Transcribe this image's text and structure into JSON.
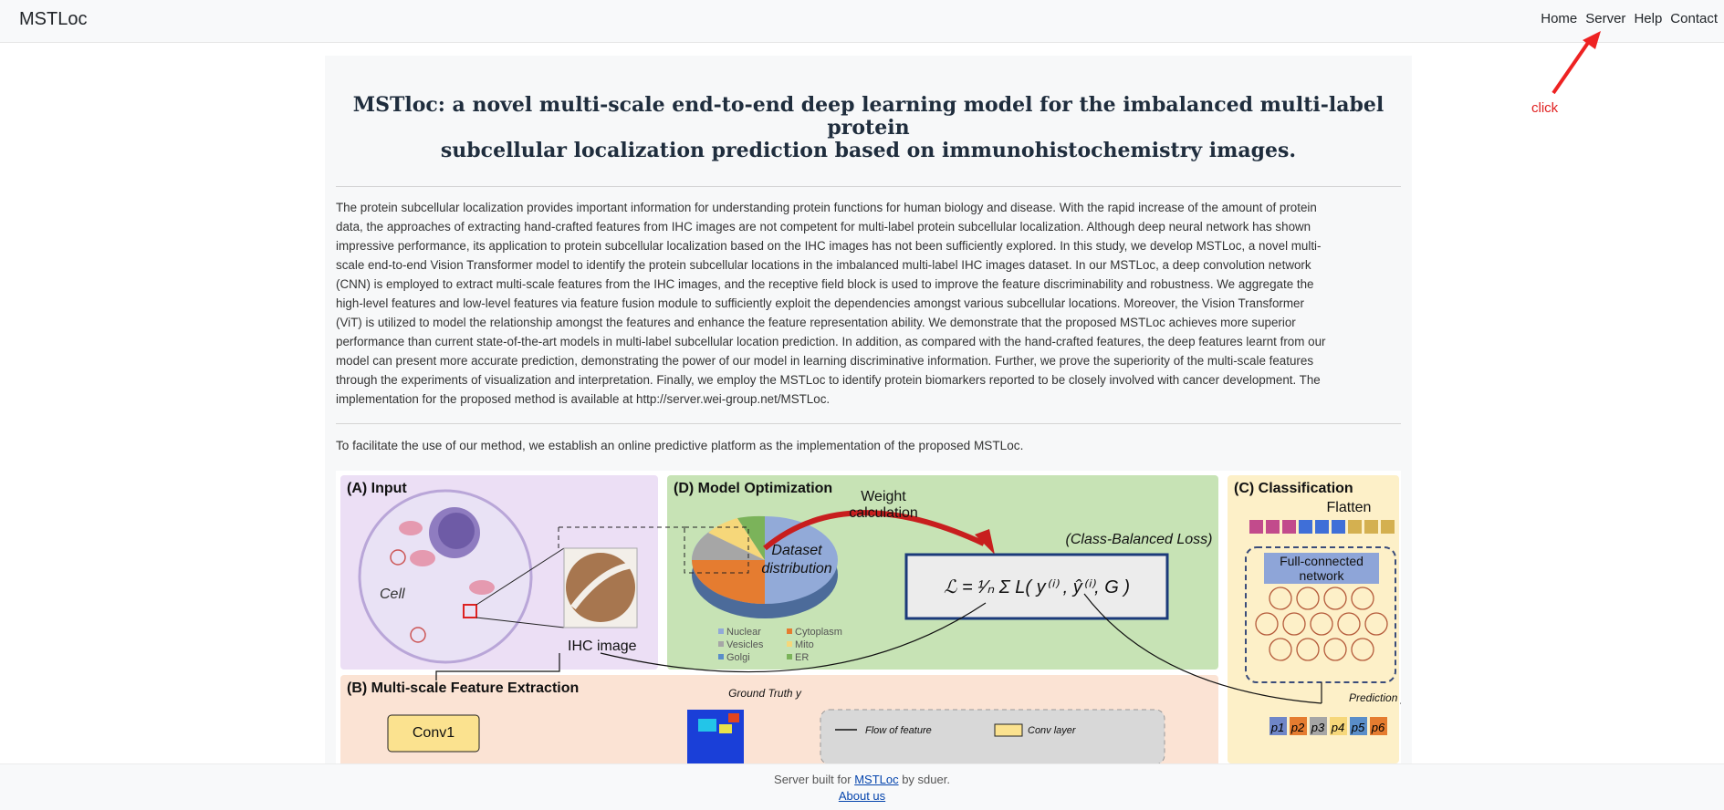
{
  "nav": {
    "brand": "MSTLoc",
    "links": [
      "Home",
      "Server",
      "Help",
      "Contact"
    ]
  },
  "annotation": {
    "text": "click",
    "color": "#e02020"
  },
  "article": {
    "title_line1": "MSTloc: a novel multi-scale end-to-end deep learning model for the imbalanced multi-label protein",
    "title_line2": "subcellular localization prediction based on immunohistochemistry images.",
    "abstract_lines": [
      "The protein subcellular localization provides important information for understanding protein functions for human biology and disease. With the rapid increase of the amount of protein",
      "data, the approaches of extracting hand-crafted features from IHC images are not competent for multi-label protein subcellular localization. Although deep neural network has shown",
      "impressive performance, its application to protein subcellular localization based on the IHC images has not been sufficiently explored. In this study, we develop MSTLoc, a novel multi-",
      "scale end-to-end Vision Transformer model to identify the protein subcellular locations in the imbalanced multi-label IHC images dataset. In our MSTLoc, a deep convolution network",
      "(CNN) is employed to extract multi-scale features from the IHC images, and the receptive field block is used to improve the feature discriminability and robustness. We aggregate the",
      "high-level features and low-level features via feature fusion module to sufficiently exploit the dependencies amongst various subcellular locations. Moreover, the Vision Transformer",
      "(ViT) is utilized to model the relationship amongst the features and enhance the feature representation ability. We demonstrate that the proposed MSTLoc achieves more superior",
      "performance than current state-of-the-art models in multi-label subcellular location prediction. In addition, as compared with the hand-crafted features, the deep features learnt from our",
      "model can present more accurate prediction, demonstrating the power of our model in learning discriminative information. Further, we prove the superiority of the multi-scale features",
      "through the experiments of visualization and interpretation. Finally, we employ the MSTLoc to identify protein biomarkers reported to be closely involved with cancer development. The",
      "implementation for the proposed method is available at http://server.wei-group.net/MSTLoc."
    ],
    "platform_note": "To facilitate the use of our method, we establish an online predictive platform as the implementation of the proposed MSTLoc."
  },
  "figure": {
    "panel_a_title": "(A) Input",
    "cell_label": "Cell",
    "ihc_label": "IHC image",
    "panel_d_title": "(D) Model Optimization",
    "weight_label_1": "Weight",
    "weight_label_2": "calculation",
    "dataset_label_1": "Dataset",
    "dataset_label_2": "distribution",
    "loss_label": "(Class-Balanced Loss)",
    "legend": [
      "Nuclear",
      "Cytoplasm",
      "Vesicles",
      "Mito",
      "Golgi",
      "ER"
    ],
    "panel_c_title": "(C) Classification",
    "flatten_label": "Flatten",
    "fc_label_1": "Full-connected",
    "fc_label_2": "network",
    "prediction_label": "Prediction ŷ",
    "panel_b_title": "(B) Multi-scale Feature Extraction",
    "ground_truth_label": "Ground Truth y",
    "conv1_label": "Conv1",
    "flow_label": "Flow of feature",
    "conv_layer_label": "Conv layer",
    "outputs": [
      "p1",
      "p2",
      "p3",
      "p4",
      "p5",
      "p6"
    ],
    "colors": {
      "panel_a": "#ecdff5",
      "panel_d": "#c7e3b5",
      "panel_c": "#fdf0c8",
      "panel_b": "#fbe3d4"
    }
  },
  "footer": {
    "built_prefix": "Server built for ",
    "built_link": "MSTLoc",
    "built_suffix": " by sduer.",
    "about": "About us"
  }
}
